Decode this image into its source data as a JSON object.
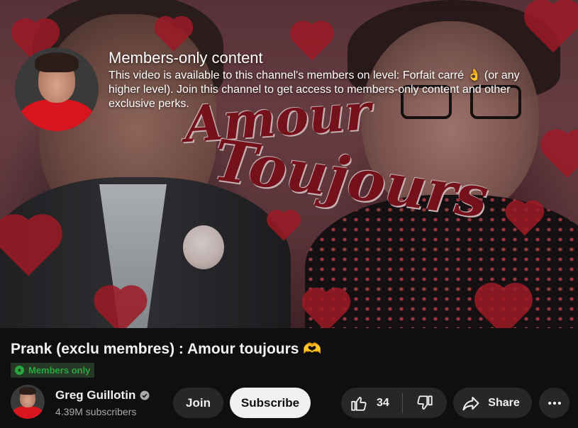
{
  "player": {
    "art_title_line1": "Amour",
    "art_title_line2": "Toujours",
    "members_overlay": {
      "heading": "Members-only content",
      "description": "This video is available to this channel's members on level: Forfait carré 👌 (or any higher level). Join this channel to get access to members-only content and other exclusive perks."
    }
  },
  "video": {
    "title": "Prank (exclu membres) : Amour toujours 🫶",
    "badge": "Members only"
  },
  "channel": {
    "name": "Greg Guillotin",
    "subscribers": "4.39M subscribers",
    "verified": true
  },
  "actions": {
    "join_label": "Join",
    "subscribe_label": "Subscribe",
    "like_count": "34",
    "share_label": "Share"
  },
  "icons": {
    "badge": "members-only-icon",
    "verified": "verified-check-icon",
    "like": "thumbs-up-icon",
    "dislike": "thumbs-down-icon",
    "share": "share-arrow-icon",
    "more": "more-horizontal-icon"
  },
  "colors": {
    "background": "#0f0f0f",
    "button_bg": "#272727",
    "subscribe_bg": "#f1f1f1",
    "members_green": "#2ba640",
    "heart_red": "#c0202e"
  }
}
